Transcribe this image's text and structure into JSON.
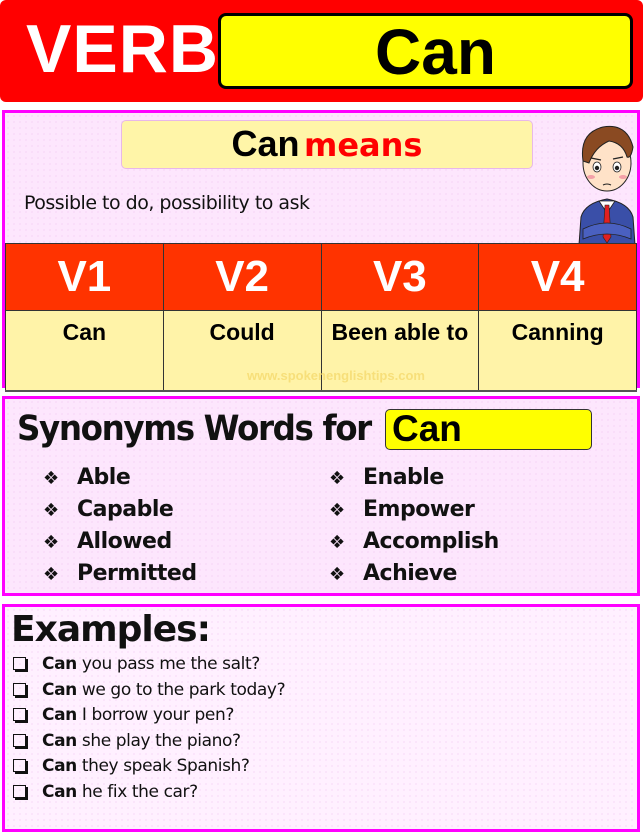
{
  "header": {
    "label": "VERB",
    "word": "Can"
  },
  "meaning_panel": {
    "title_word": "Can",
    "title_suffix": "means",
    "definition": "Possible to do, possibility to ask",
    "character_icon": "confused-businessman-illustration"
  },
  "verb_forms": {
    "headers": [
      "V1",
      "V2",
      "V3",
      "V4"
    ],
    "values": [
      "Can",
      "Could",
      "Been able to",
      "Canning"
    ],
    "watermark": "www.spokenenglishtips.com"
  },
  "synonyms": {
    "title": "Synonyms Words for",
    "word": "Can",
    "bullet_icon": "❖",
    "column1": [
      "Able",
      "Capable",
      "Allowed",
      "Permitted"
    ],
    "column2": [
      "Enable",
      "Empower",
      "Accomplish",
      "Achieve"
    ]
  },
  "examples": {
    "title": "Examples:",
    "items": [
      {
        "keyword": "Can",
        "text": "you pass me the salt?"
      },
      {
        "keyword": "Can",
        "text": "we go to the park today?"
      },
      {
        "keyword": "Can",
        "text": "I borrow your pen?"
      },
      {
        "keyword": "Can",
        "text": "she play the piano?"
      },
      {
        "keyword": "Can",
        "text": "they speak Spanish?"
      },
      {
        "keyword": "Can",
        "text": "he fix the car?"
      }
    ]
  },
  "colors": {
    "header_red": "#ff0000",
    "highlight_yellow": "#ffff00",
    "border_magenta": "#ff00ff",
    "table_header": "#ff3300",
    "table_cell": "#fff3a8"
  }
}
